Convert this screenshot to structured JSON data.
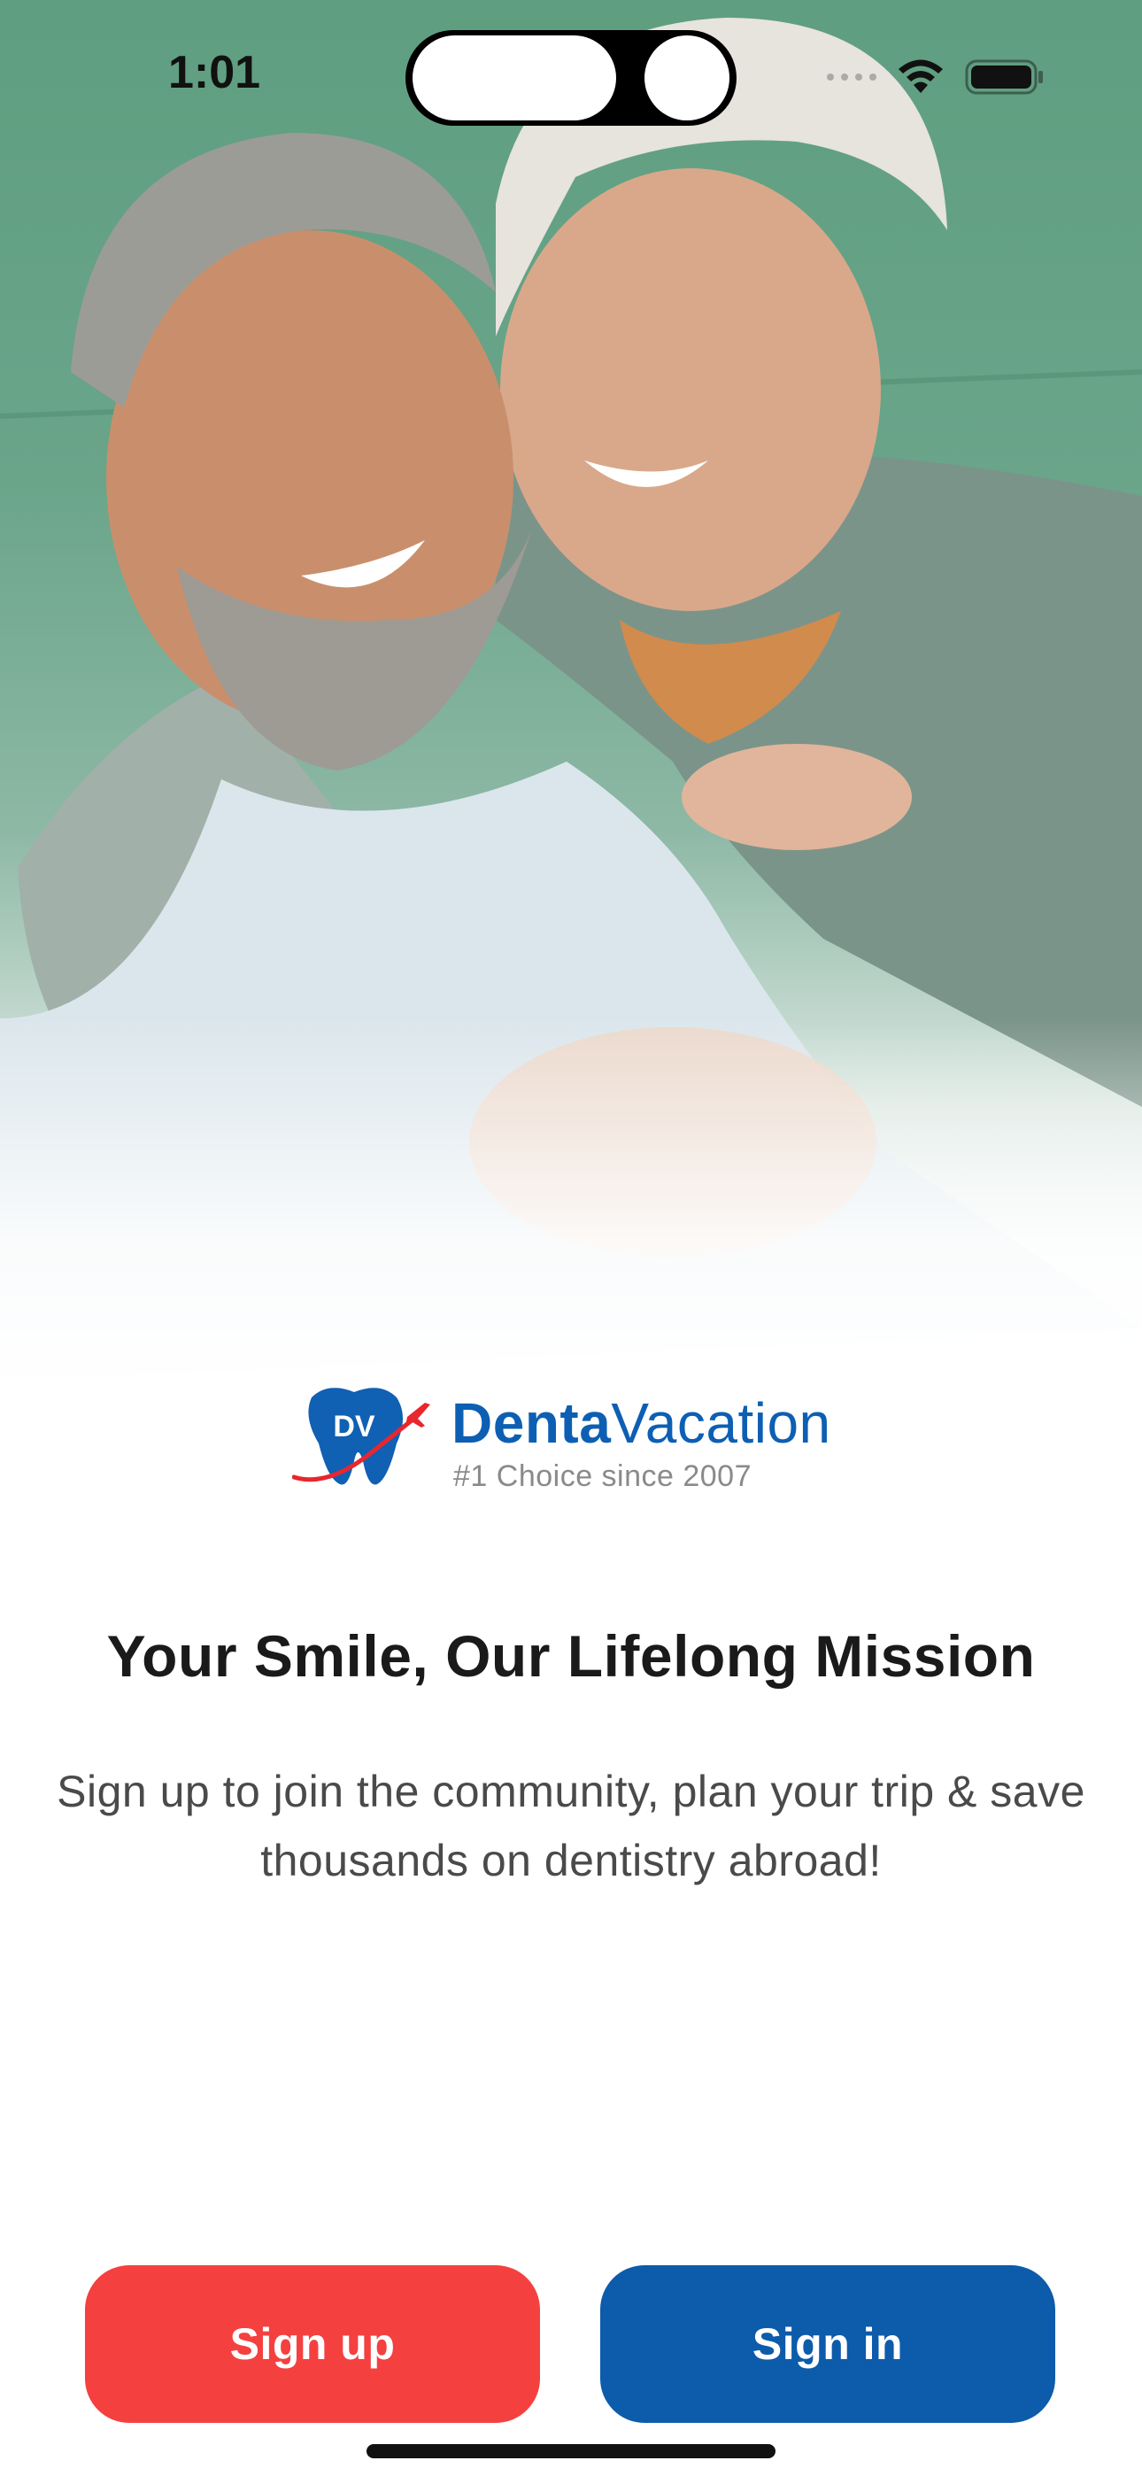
{
  "status_bar": {
    "time": "1:01",
    "icons": [
      "signal-dots-icon",
      "wifi-icon",
      "battery-icon"
    ]
  },
  "hero": {
    "image": "smiling-senior-couple-photo"
  },
  "brand": {
    "mark_text": "DV",
    "name_strong": "Denta",
    "name_light": "Vacation",
    "tagline": "#1 Choice since 2007",
    "colors": {
      "primary_blue": "#0d5fb3",
      "accent_red": "#e8262e"
    }
  },
  "content": {
    "headline": "Your Smile, Our Lifelong Mission",
    "subtext": "Sign up to join the community, plan your trip & save thousands on dentistry abroad!"
  },
  "actions": {
    "signup_label": "Sign up",
    "signin_label": "Sign in",
    "colors": {
      "signup_bg": "#f54040",
      "signin_bg": "#0d5bab"
    }
  }
}
